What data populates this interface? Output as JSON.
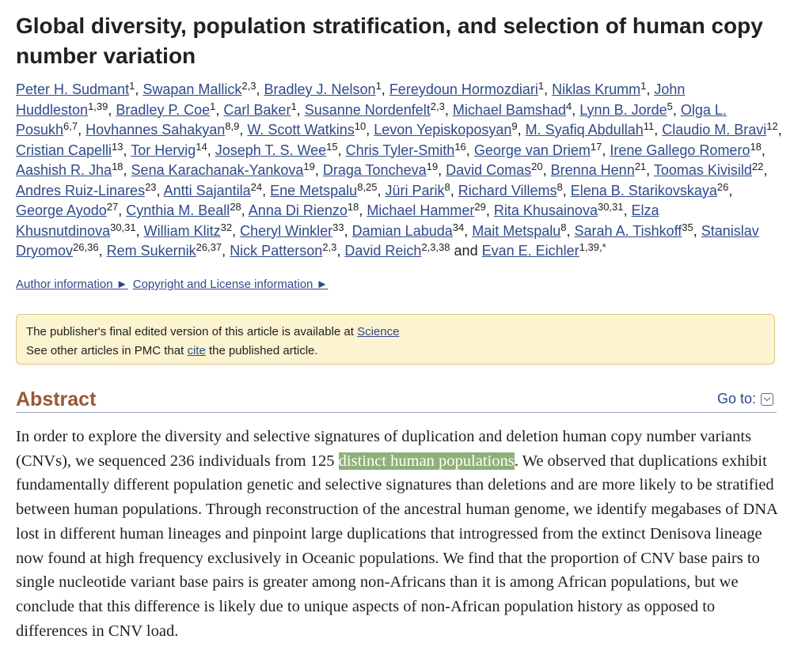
{
  "article": {
    "title": "Global diversity, population stratification, and selection of human copy number variation"
  },
  "authors": [
    {
      "name": "Peter H. Sudmant",
      "sup": "1"
    },
    {
      "name": "Swapan Mallick",
      "sup": "2,3"
    },
    {
      "name": "Bradley J. Nelson",
      "sup": "1"
    },
    {
      "name": "Fereydoun Hormozdiari",
      "sup": "1"
    },
    {
      "name": "Niklas Krumm",
      "sup": "1"
    },
    {
      "name": "John Huddleston",
      "sup": "1,39"
    },
    {
      "name": "Bradley P. Coe",
      "sup": "1"
    },
    {
      "name": "Carl Baker",
      "sup": "1"
    },
    {
      "name": "Susanne Nordenfelt",
      "sup": "2,3"
    },
    {
      "name": "Michael Bamshad",
      "sup": "4"
    },
    {
      "name": "Lynn B. Jorde",
      "sup": "5"
    },
    {
      "name": "Olga L. Posukh",
      "sup": "6,7"
    },
    {
      "name": "Hovhannes Sahakyan",
      "sup": "8,9"
    },
    {
      "name": "W. Scott Watkins",
      "sup": "10"
    },
    {
      "name": "Levon Yepiskoposyan",
      "sup": "9"
    },
    {
      "name": "M. Syafiq Abdullah",
      "sup": "11"
    },
    {
      "name": "Claudio M. Bravi",
      "sup": "12"
    },
    {
      "name": "Cristian Capelli",
      "sup": "13"
    },
    {
      "name": "Tor Hervig",
      "sup": "14"
    },
    {
      "name": "Joseph T. S. Wee",
      "sup": "15"
    },
    {
      "name": "Chris Tyler-Smith",
      "sup": "16"
    },
    {
      "name": "George van Driem",
      "sup": "17"
    },
    {
      "name": "Irene Gallego Romero",
      "sup": "18"
    },
    {
      "name": "Aashish R. Jha",
      "sup": "18"
    },
    {
      "name": "Sena Karachanak-Yankova",
      "sup": "19"
    },
    {
      "name": "Draga Toncheva",
      "sup": "19"
    },
    {
      "name": "David Comas",
      "sup": "20"
    },
    {
      "name": "Brenna Henn",
      "sup": "21"
    },
    {
      "name": "Toomas Kivisild",
      "sup": "22"
    },
    {
      "name": "Andres Ruiz-Linares",
      "sup": "23"
    },
    {
      "name": "Antti Sajantila",
      "sup": "24"
    },
    {
      "name": "Ene Metspalu",
      "sup": "8,25"
    },
    {
      "name": "Jüri Parik",
      "sup": "8"
    },
    {
      "name": "Richard Villems",
      "sup": "8"
    },
    {
      "name": "Elena B. Starikovskaya",
      "sup": "26"
    },
    {
      "name": "George Ayodo",
      "sup": "27"
    },
    {
      "name": "Cynthia M. Beall",
      "sup": "28"
    },
    {
      "name": "Anna Di Rienzo",
      "sup": "18"
    },
    {
      "name": "Michael Hammer",
      "sup": "29"
    },
    {
      "name": "Rita Khusainova",
      "sup": "30,31"
    },
    {
      "name": "Elza Khusnutdinova",
      "sup": "30,31"
    },
    {
      "name": "William Klitz",
      "sup": "32"
    },
    {
      "name": "Cheryl Winkler",
      "sup": "33"
    },
    {
      "name": "Damian Labuda",
      "sup": "34"
    },
    {
      "name": "Mait Metspalu",
      "sup": "8"
    },
    {
      "name": "Sarah A. Tishkoff",
      "sup": "35"
    },
    {
      "name": "Stanislav Dryomov",
      "sup": "26,36"
    },
    {
      "name": "Rem Sukernik",
      "sup": "26,37"
    },
    {
      "name": "Nick Patterson",
      "sup": "2,3"
    },
    {
      "name": "David Reich",
      "sup": "2,3,38"
    },
    {
      "name": "Evan E. Eichler",
      "sup": "1,39,*"
    }
  ],
  "authors_conjunction": "and",
  "info_links": {
    "author_info": "Author information ►",
    "copyright": "Copyright and License information ►"
  },
  "notice": {
    "line1_text": "The publisher's final edited version of this article is available at ",
    "line1_link": "Science",
    "line2_prefix": "See other articles in PMC that ",
    "line2_link": "cite",
    "line2_suffix": " the published article."
  },
  "abstract": {
    "heading": "Abstract",
    "goto_label": "Go to:",
    "text_before": "In order to explore the diversity and selective signatures of duplication and deletion human copy number variants (CNVs), we sequenced 236 individuals from 125 ",
    "highlight": "distinct human populations",
    "text_after": ". We observed that duplications exhibit fundamentally different population genetic and selective signatures than deletions and are more likely to be stratified between human populations. Through reconstruction of the ancestral human genome, we identify megabases of DNA lost in different human lineages and pinpoint large duplications that introgressed from the extinct Denisova lineage now found at high frequency exclusively in Oceanic populations. We find that the proportion of CNV base pairs to single nucleotide variant base pairs is greater among non-Africans than it is among African populations, but we conclude that this difference is likely due to unique aspects of non-African population history as opposed to differences in CNV load."
  },
  "colors": {
    "link": "#2f4a8a",
    "abstract_heading": "#985735",
    "notice_bg": "#fcf3d1",
    "highlight": "#8fb07a"
  }
}
